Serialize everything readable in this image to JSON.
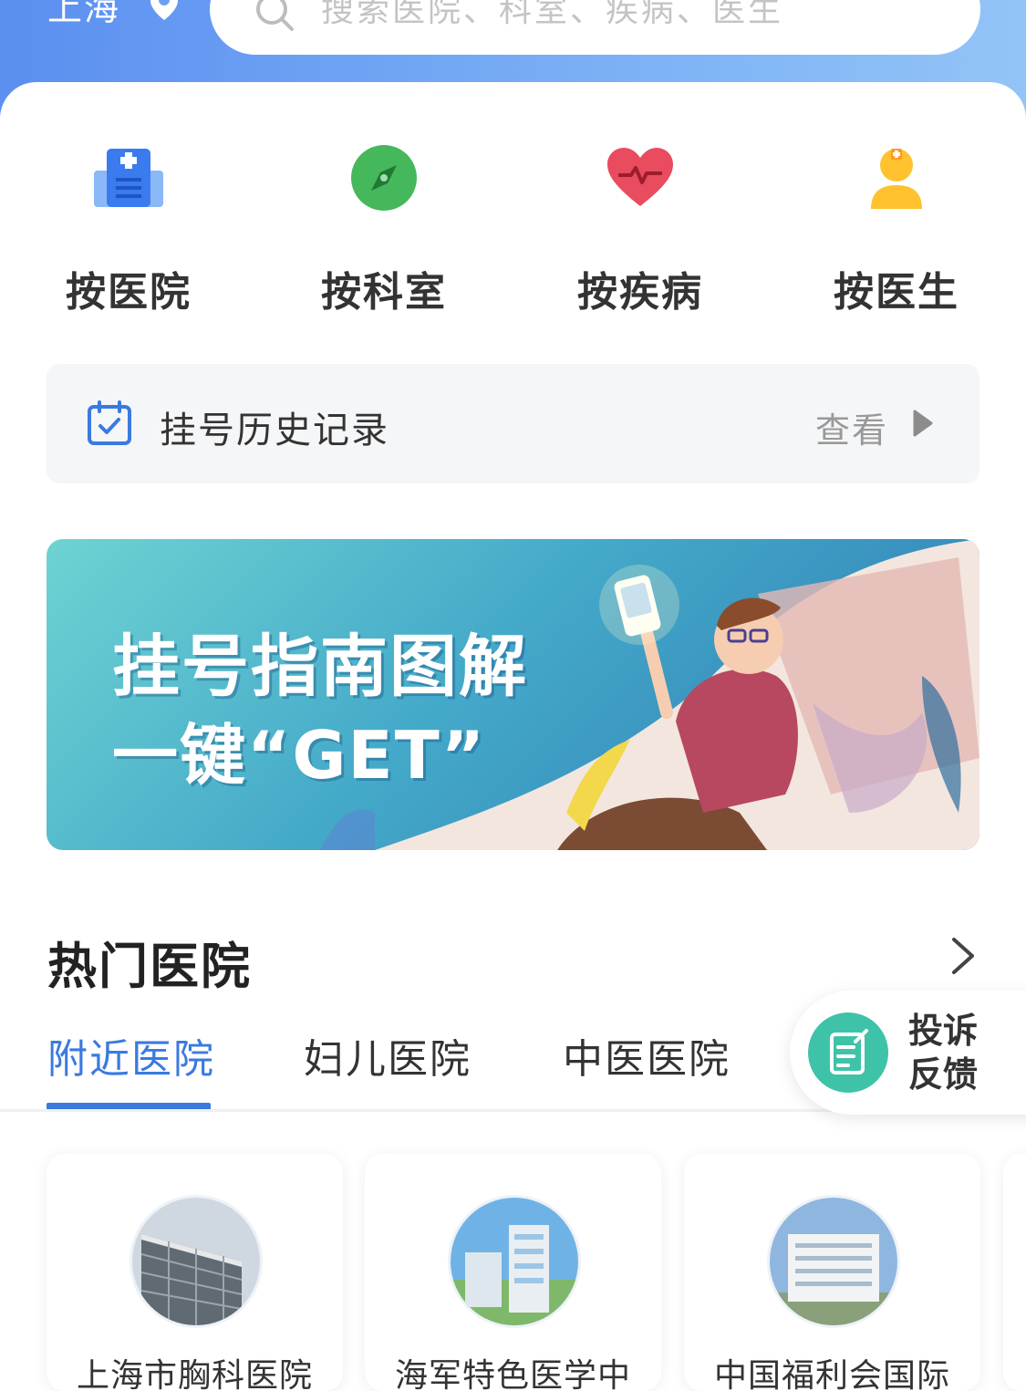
{
  "header": {
    "city": "上海",
    "search_placeholder": "搜索医院、科室、疾病、医生"
  },
  "categories": [
    {
      "label": "按医院",
      "icon": "hospital-icon"
    },
    {
      "label": "按科室",
      "icon": "compass-icon"
    },
    {
      "label": "按疾病",
      "icon": "heart-pulse-icon"
    },
    {
      "label": "按医生",
      "icon": "doctor-icon"
    }
  ],
  "history": {
    "label": "挂号历史记录",
    "view": "查看"
  },
  "banner": {
    "line1": "挂号指南图解",
    "line2": "一键“GET”"
  },
  "hot": {
    "title": "热门医院",
    "tabs": [
      "附近医院",
      "妇儿医院",
      "中医医院"
    ],
    "active_tab": "附近医院"
  },
  "complaint": {
    "line1": "投诉",
    "line2": "反馈"
  },
  "hospitals": [
    {
      "name": "上海市胸科医院"
    },
    {
      "name": "海军特色医学中"
    },
    {
      "name": "中国福利会国际"
    }
  ],
  "colors": {
    "accent": "#3a7ae0",
    "header_start": "#5b8ff0",
    "header_end": "#93c4f7",
    "complaint": "#3ec3a8"
  }
}
